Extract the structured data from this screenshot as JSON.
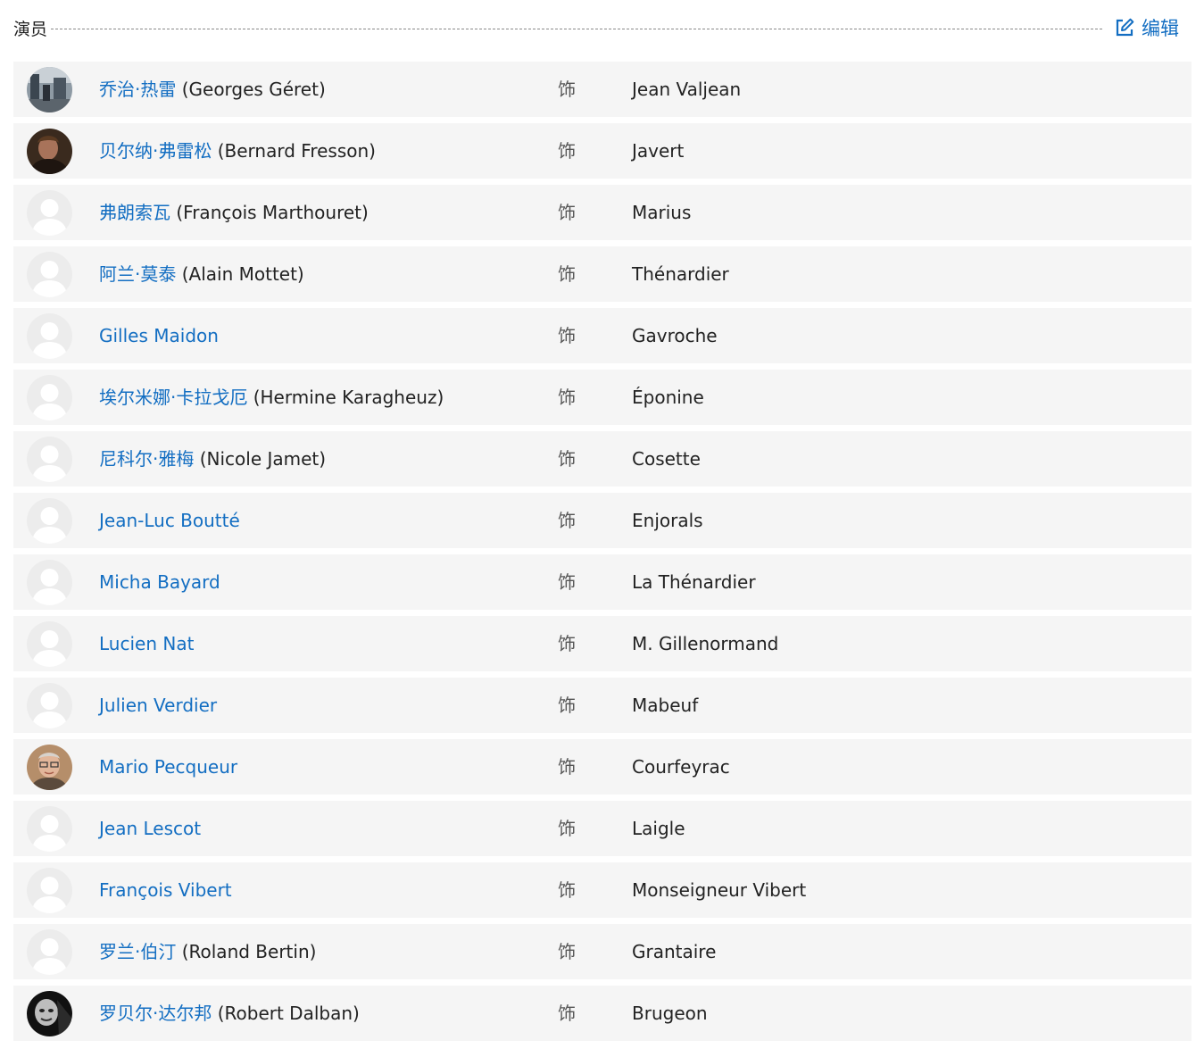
{
  "section": {
    "title": "演员",
    "edit_label": "编辑",
    "edit_icon": "edit-icon"
  },
  "as_word": "饰",
  "cast": [
    {
      "name": "乔治·热雷",
      "original": " (Georges Géret)",
      "role": "Jean Valjean",
      "avatar": "photo-street"
    },
    {
      "name": "贝尔纳·弗雷松",
      "original": " (Bernard Fresson)",
      "role": "Javert",
      "avatar": "photo-man-dark"
    },
    {
      "name": "弗朗索瓦",
      "original": " (François Marthouret)",
      "role": "Marius",
      "avatar": "placeholder"
    },
    {
      "name": "阿兰·莫泰",
      "original": " (Alain Mottet)",
      "role": "Thénardier",
      "avatar": "placeholder"
    },
    {
      "name": "Gilles Maidon",
      "original": "",
      "role": "Gavroche",
      "avatar": "placeholder"
    },
    {
      "name": "埃尔米娜·卡拉戈厄",
      "original": " (Hermine Karagheuz)",
      "role": "Éponine",
      "avatar": "placeholder"
    },
    {
      "name": "尼科尔·雅梅",
      "original": " (Nicole Jamet)",
      "role": "Cosette",
      "avatar": "placeholder"
    },
    {
      "name": "Jean-Luc Boutté",
      "original": "",
      "role": "Enjorals",
      "avatar": "placeholder"
    },
    {
      "name": "Micha Bayard",
      "original": "",
      "role": "La Thénardier",
      "avatar": "placeholder"
    },
    {
      "name": "Lucien Nat",
      "original": "",
      "role": "M. Gillenormand",
      "avatar": "placeholder"
    },
    {
      "name": "Julien Verdier",
      "original": "",
      "role": "Mabeuf",
      "avatar": "placeholder"
    },
    {
      "name": "Mario Pecqueur",
      "original": "",
      "role": "Courfeyrac",
      "avatar": "photo-man-glasses"
    },
    {
      "name": "Jean Lescot",
      "original": "",
      "role": "Laigle",
      "avatar": "placeholder"
    },
    {
      "name": "François Vibert",
      "original": "",
      "role": "Monseigneur Vibert",
      "avatar": "placeholder"
    },
    {
      "name": "罗兰·伯汀",
      "original": " (Roland Bertin)",
      "role": "Grantaire",
      "avatar": "placeholder"
    },
    {
      "name": "罗贝尔·达尔邦",
      "original": " (Robert Dalban)",
      "role": "Brugeon",
      "avatar": "photo-bw"
    }
  ],
  "colors": {
    "link": "#136ec2",
    "row_bg": "#f5f5f5",
    "text": "#222222"
  }
}
